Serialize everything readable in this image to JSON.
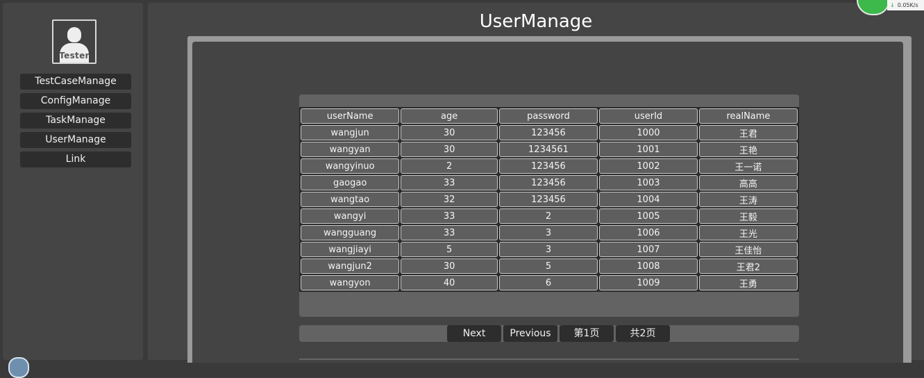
{
  "sidebar": {
    "avatar_label": "Tester",
    "items": [
      {
        "label": "TestCaseManage"
      },
      {
        "label": "ConfigManage"
      },
      {
        "label": "TaskManage"
      },
      {
        "label": "UserManage"
      },
      {
        "label": "Link"
      }
    ]
  },
  "main": {
    "title": "UserManage"
  },
  "table": {
    "columns": [
      "userName",
      "age",
      "password",
      "userId",
      "realName"
    ],
    "rows": [
      [
        "wangjun",
        "30",
        "123456",
        "1000",
        "王君"
      ],
      [
        "wangyan",
        "30",
        "1234561",
        "1001",
        "王艳"
      ],
      [
        "wangyinuo",
        "2",
        "123456",
        "1002",
        "王一诺"
      ],
      [
        "gaogao",
        "33",
        "123456",
        "1003",
        "高高"
      ],
      [
        "wangtao",
        "32",
        "123456",
        "1004",
        "王涛"
      ],
      [
        "wangyi",
        "33",
        "2",
        "1005",
        "王毅"
      ],
      [
        "wangguang",
        "33",
        "3",
        "1006",
        "王光"
      ],
      [
        "wangjiayi",
        "5",
        "3",
        "1007",
        "王佳怡"
      ],
      [
        "wangjun2",
        "30",
        "5",
        "1008",
        "王君2"
      ],
      [
        "wangyon",
        "40",
        "6",
        "1009",
        "王勇"
      ]
    ]
  },
  "pager": {
    "next_label": "Next",
    "previous_label": "Previous",
    "current_page": "第1页",
    "total_pages": "共2页"
  },
  "widget": {
    "speed": "0.05K/s",
    "ball_color": "#3cb94a"
  },
  "colors": {
    "background": "#3a3a3a",
    "panel": "#454545",
    "button": "#2d2d2d",
    "cell": "#5e5e5e"
  }
}
